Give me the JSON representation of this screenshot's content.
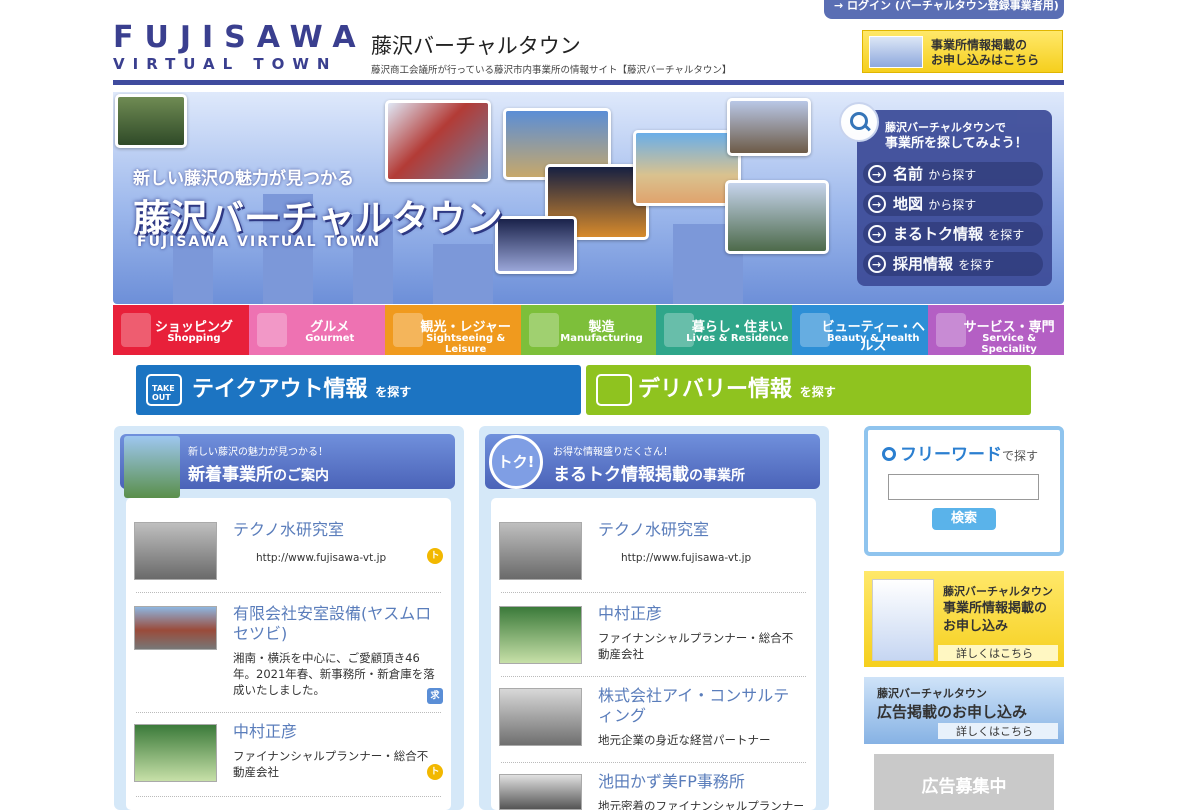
{
  "header": {
    "login": "→ ログイン (バーチャルタウン登録事業者用)",
    "logo_main": "FUJISAWA",
    "logo_sub": "VIRTUAL TOWN",
    "site_title": "藤沢バーチャルタウン",
    "site_desc": "藤沢商工会議所が行っている藤沢市内事業所の情報サイト【藤沢バーチャルタウン】",
    "apply_line1": "事業所情報掲載の",
    "apply_line2": "お申し込みはこちら"
  },
  "hero": {
    "catch": "新しい藤沢の魅力が見つかる",
    "title": "藤沢バーチャルタウン",
    "en": "FUJISAWA VIRTUAL TOWN",
    "panel_line1": "藤沢バーチャルタウンで",
    "panel_line2": "事業所を探してみよう！",
    "search_items": [
      {
        "main": "名前",
        "suffix": "から探す"
      },
      {
        "main": "地図",
        "suffix": "から探す"
      },
      {
        "main": "まるトク情報",
        "suffix": "を探す"
      },
      {
        "main": "採用情報",
        "suffix": "を探す"
      }
    ]
  },
  "categories": [
    {
      "jp": "ショッピング",
      "en": "Shopping",
      "color": "#e8203a"
    },
    {
      "jp": "グルメ",
      "en": "Gourmet",
      "color": "#ee72b2"
    },
    {
      "jp": "観光・レジャー",
      "en": "Sightseeing & Leisure",
      "color": "#f09a1e"
    },
    {
      "jp": "製造",
      "en": "Manufacturing",
      "color": "#7dbf3a"
    },
    {
      "jp": "暮らし・住まい",
      "en": "Lives & Residence",
      "color": "#2fa68a"
    },
    {
      "jp": "ビューティー・ヘルス",
      "en": "Beauty & Health",
      "color": "#2d8fd6"
    },
    {
      "jp": "サービス・専門",
      "en": "Service & Speciality",
      "color": "#b45fc4"
    }
  ],
  "takeout": {
    "main": "テイクアウト情報",
    "suffix": "を探す",
    "badge": "TAKE OUT",
    "color": "#1c74c2"
  },
  "delivery": {
    "main": "デリバリー情報",
    "suffix": "を探す",
    "color": "#8fc31f"
  },
  "new_arrivals": {
    "sub": "新しい藤沢の魅力が見つかる！",
    "title": "新着事業所",
    "title_suffix": "のご案内",
    "items": [
      {
        "name": "テクノ水研究室",
        "desc": "http://www.fujisawa-vt.jp",
        "tag": "トク"
      },
      {
        "name": "有限会社安室設備(ヤスムロセツビ)",
        "desc": "湘南・横浜を中心に、ご愛顧頂き46年。2021年春、新事務所・新倉庫を落成いたしました。",
        "tag": "求"
      },
      {
        "name": "中村正彦",
        "desc": "ファイナンシャルプランナー・総合不動産会社",
        "tag": "トク"
      }
    ]
  },
  "marutoku": {
    "badge": "トク!",
    "sub": "お得な情報盛りだくさん！",
    "title": "まるトク情報掲載",
    "title_suffix": "の事業所",
    "items": [
      {
        "name": "テクノ水研究室",
        "desc": "http://www.fujisawa-vt.jp"
      },
      {
        "name": "中村正彦",
        "desc": "ファイナンシャルプランナー・総合不動産会社"
      },
      {
        "name": "株式会社アイ・コンサルティング",
        "desc": "地元企業の身近な経営パートナー"
      },
      {
        "name": "池田かず美FP事務所",
        "desc": "地元密着のファイナンシャルプランナー"
      }
    ]
  },
  "freeword": {
    "title": "フリーワード",
    "suffix": "で探す",
    "input_value": "",
    "button": "検索"
  },
  "banner_apply": {
    "line1": "藤沢バーチャルタウン",
    "line2": "事業所情報掲載の",
    "line3": "お申し込み",
    "more": "詳しくはこちら"
  },
  "banner_ad": {
    "line1": "藤沢バーチャルタウン",
    "line2": "広告掲載のお申し込み",
    "more": "詳しくはこちら"
  },
  "ad_space": "広告募集中"
}
